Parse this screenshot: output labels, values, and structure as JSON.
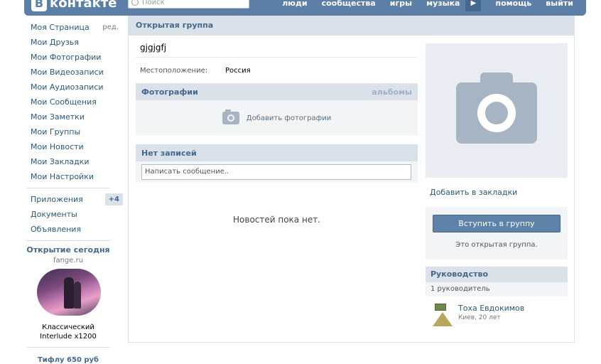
{
  "header": {
    "logo_text": "контакте",
    "logo_letter": "В",
    "search_placeholder": "Поиск",
    "nav": [
      "люди",
      "сообщества",
      "игры",
      "музыка",
      "помощь",
      "выйти"
    ],
    "more_arrow": "▶"
  },
  "sidebar": {
    "items": [
      {
        "label": "Моя Страница",
        "edit": "ред."
      },
      {
        "label": "Мои Друзья"
      },
      {
        "label": "Мои Фотографии"
      },
      {
        "label": "Мои Видеозаписи"
      },
      {
        "label": "Мои Аудиозаписи"
      },
      {
        "label": "Мои Сообщения"
      },
      {
        "label": "Мои Заметки"
      },
      {
        "label": "Мои Группы"
      },
      {
        "label": "Мои Новости"
      },
      {
        "label": "Мои Закладки"
      },
      {
        "label": "Мои Настройки"
      }
    ],
    "extra": [
      {
        "label": "Приложения",
        "badge": "+4"
      },
      {
        "label": "Документы"
      },
      {
        "label": "Объявления"
      }
    ],
    "promo": {
      "title": "Открытие сегодня",
      "site": "fange.ru",
      "caption_line1": "Классический",
      "caption_line2": "Interlude x1200",
      "next": "Тифлу 650 руб"
    }
  },
  "main": {
    "header": "Открытая группа",
    "group_name": "gjgjgfj",
    "location_label": "Местоположение:",
    "location_value": "Россия",
    "photos": {
      "title": "Фотографии",
      "link": "альбомы",
      "add": "Добавить фотографии"
    },
    "wall": {
      "title": "Нет записей",
      "placeholder": "Написать сообщение.."
    },
    "no_news": "Новостей пока нет."
  },
  "right": {
    "bookmark": "Добавить в закладки",
    "join_button": "Вступить в группу",
    "join_note": "Это открытая группа.",
    "management": {
      "title": "Руководство",
      "count": "1 руководитель",
      "leader_name": "Тоха Евдокимов",
      "leader_sub": "Киев, 20 лет"
    }
  },
  "colors": {
    "header_bg": "#5b7fa6",
    "link": "#2b587a",
    "section_bg": "#dae1e8",
    "button_bg": "#5e82a8"
  }
}
